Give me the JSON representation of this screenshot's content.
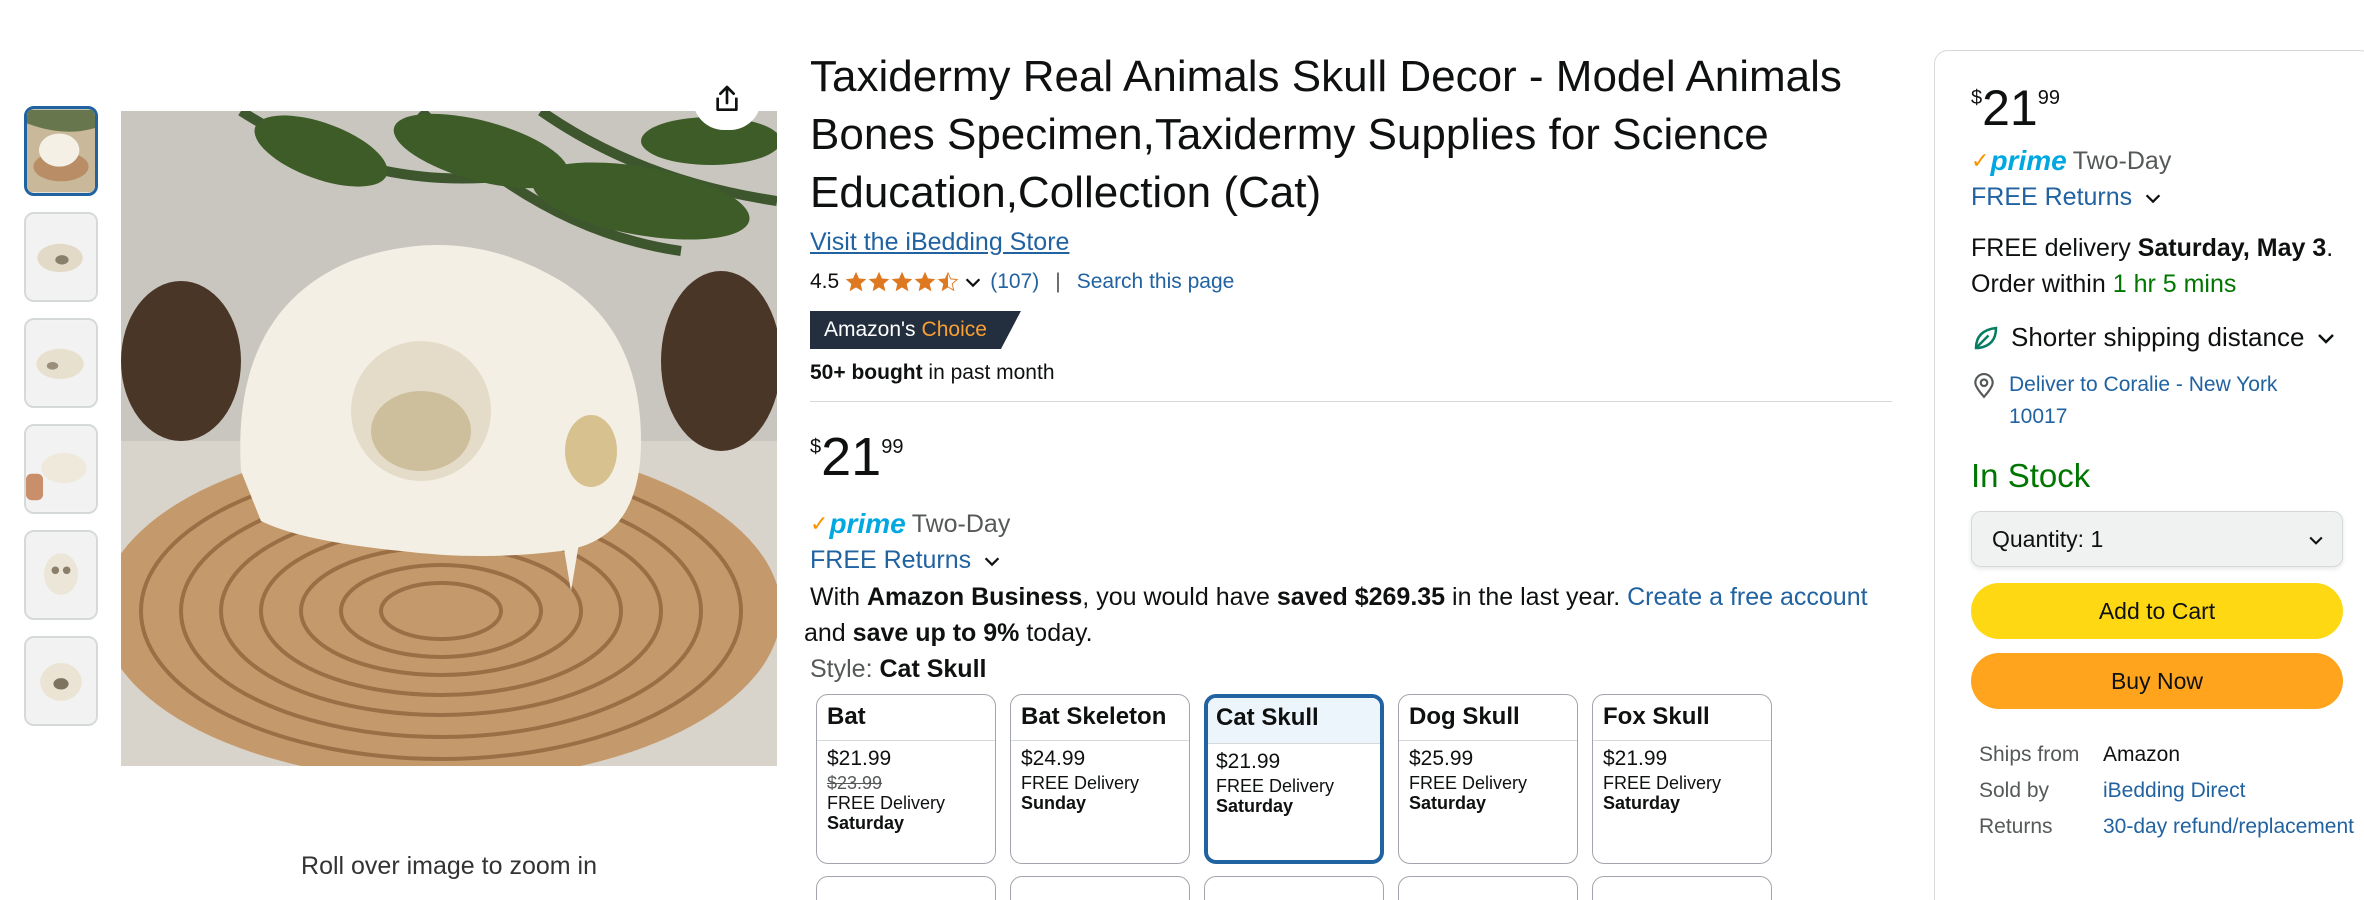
{
  "gallery": {
    "thumbnails": [
      "cat skull on wood slice",
      "skull side view",
      "skull top view",
      "skull held in hand",
      "skull front view",
      "skull bottom view"
    ],
    "zoom_hint": "Roll over image to zoom in"
  },
  "product": {
    "title": "Taxidermy Real Animals Skull Decor - Model Animals Bones Specimen,Taxidermy Supplies for Science Education,Collection (Cat)",
    "store_link": "Visit the iBedding Store",
    "rating": 4.5,
    "rating_text": "4.5",
    "rating_count": "(107)",
    "search_page": "Search this page",
    "separator": "|",
    "badge_main": "Amazon's",
    "badge_accent": "Choice",
    "bought_bold": "50+ bought",
    "bought_rest": " in past month"
  },
  "price": {
    "symbol": "$",
    "whole": "21",
    "fraction": "99"
  },
  "prime": {
    "check": "✓",
    "logo": "prime",
    "label": "Two-Day"
  },
  "returns": {
    "label": "FREE Returns"
  },
  "business": {
    "p1": "With ",
    "b1": "Amazon Business",
    "p2": ", you would have ",
    "b2": "saved $269.35",
    "p3": " in the last year. ",
    "link": "Create a free account",
    "p4": " and ",
    "b3": "save up to 9%",
    "p5": " today."
  },
  "style": {
    "label": "Style: ",
    "selected": "Cat Skull",
    "options": [
      {
        "name": "Bat",
        "price": "$21.99",
        "strike": "$23.99",
        "delivery": "FREE Delivery",
        "day": "Saturday"
      },
      {
        "name": "Bat Skeleton",
        "price": "$24.99",
        "strike": "",
        "delivery": "FREE Delivery",
        "day": "Sunday"
      },
      {
        "name": "Cat Skull",
        "price": "$21.99",
        "strike": "",
        "delivery": "FREE Delivery",
        "day": "Saturday"
      },
      {
        "name": "Dog Skull",
        "price": "$25.99",
        "strike": "",
        "delivery": "FREE Delivery",
        "day": "Saturday"
      },
      {
        "name": "Fox Skull",
        "price": "$21.99",
        "strike": "",
        "delivery": "FREE Delivery",
        "day": "Saturday"
      }
    ]
  },
  "buybox": {
    "delivery_prefix": "FREE delivery ",
    "delivery_date": "Saturday, May 3",
    "delivery_suffix": ".",
    "order_within": "Order within ",
    "countdown": "1 hr 5 mins",
    "shorter_shipping": "Shorter shipping distance",
    "deliver_to": "Deliver to Coralie - New York 10017",
    "stock": "In Stock",
    "quantity_label": "Quantity:",
    "quantity_value": "1",
    "add_to_cart": "Add to Cart",
    "buy_now": "Buy Now",
    "ships_from_label": "Ships from",
    "ships_from_value": "Amazon",
    "sold_by_label": "Sold by",
    "sold_by_value": "iBedding Direct",
    "returns_label": "Returns",
    "returns_value": "30-day refund/replacement"
  },
  "colors": {
    "link": "#2162a1",
    "add_to_cart": "#ffd814",
    "buy_now": "#ffa41c",
    "in_stock": "#007600",
    "star": "#de7921",
    "badge_bg": "#232f3e",
    "badge_accent": "#f89f33"
  },
  "icons": {
    "share": "share-icon",
    "chevron": "chevron-down-icon",
    "leaf": "leaf-icon",
    "location": "location-pin-icon",
    "star": "star-icon"
  }
}
